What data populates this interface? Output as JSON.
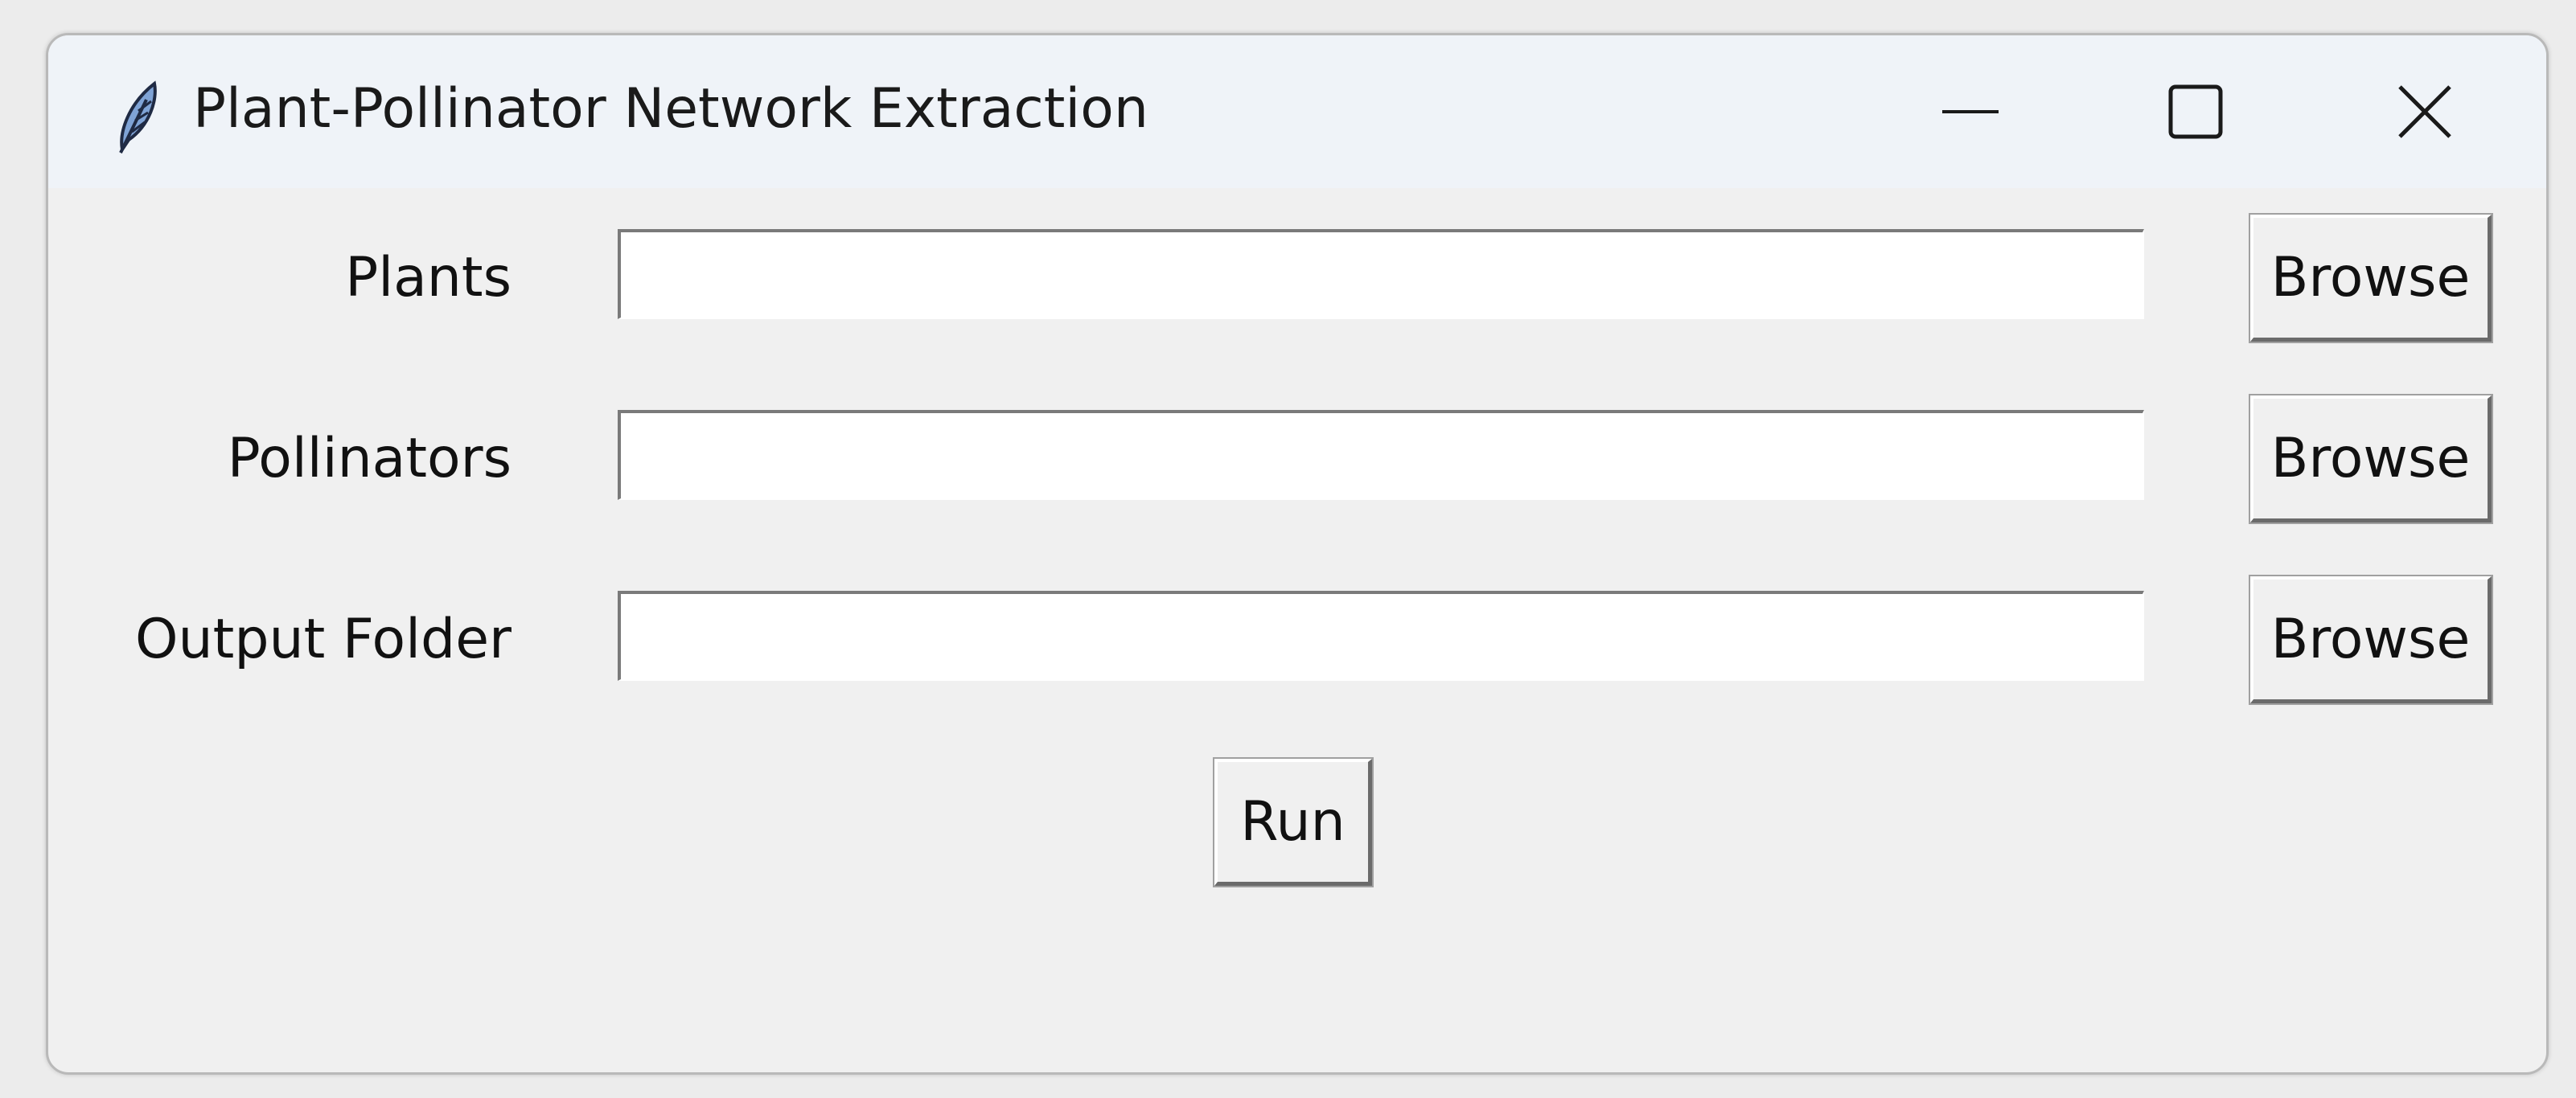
{
  "window": {
    "title": "Plant-Pollinator Network Extraction",
    "app_icon": "feather-icon",
    "controls": {
      "minimize_icon": "minimize-icon",
      "maximize_icon": "maximize-icon",
      "close_icon": "close-icon"
    }
  },
  "form": {
    "rows": [
      {
        "label": "Plants",
        "value": "",
        "button_label": "Browse"
      },
      {
        "label": "Pollinators",
        "value": "",
        "button_label": "Browse"
      },
      {
        "label": "Output Folder",
        "value": "",
        "button_label": "Browse"
      }
    ],
    "run_label": "Run"
  },
  "colors": {
    "titlebar_bg": "#eff3f8",
    "window_bg": "#f0f0f0",
    "entry_bg": "#ffffff"
  }
}
